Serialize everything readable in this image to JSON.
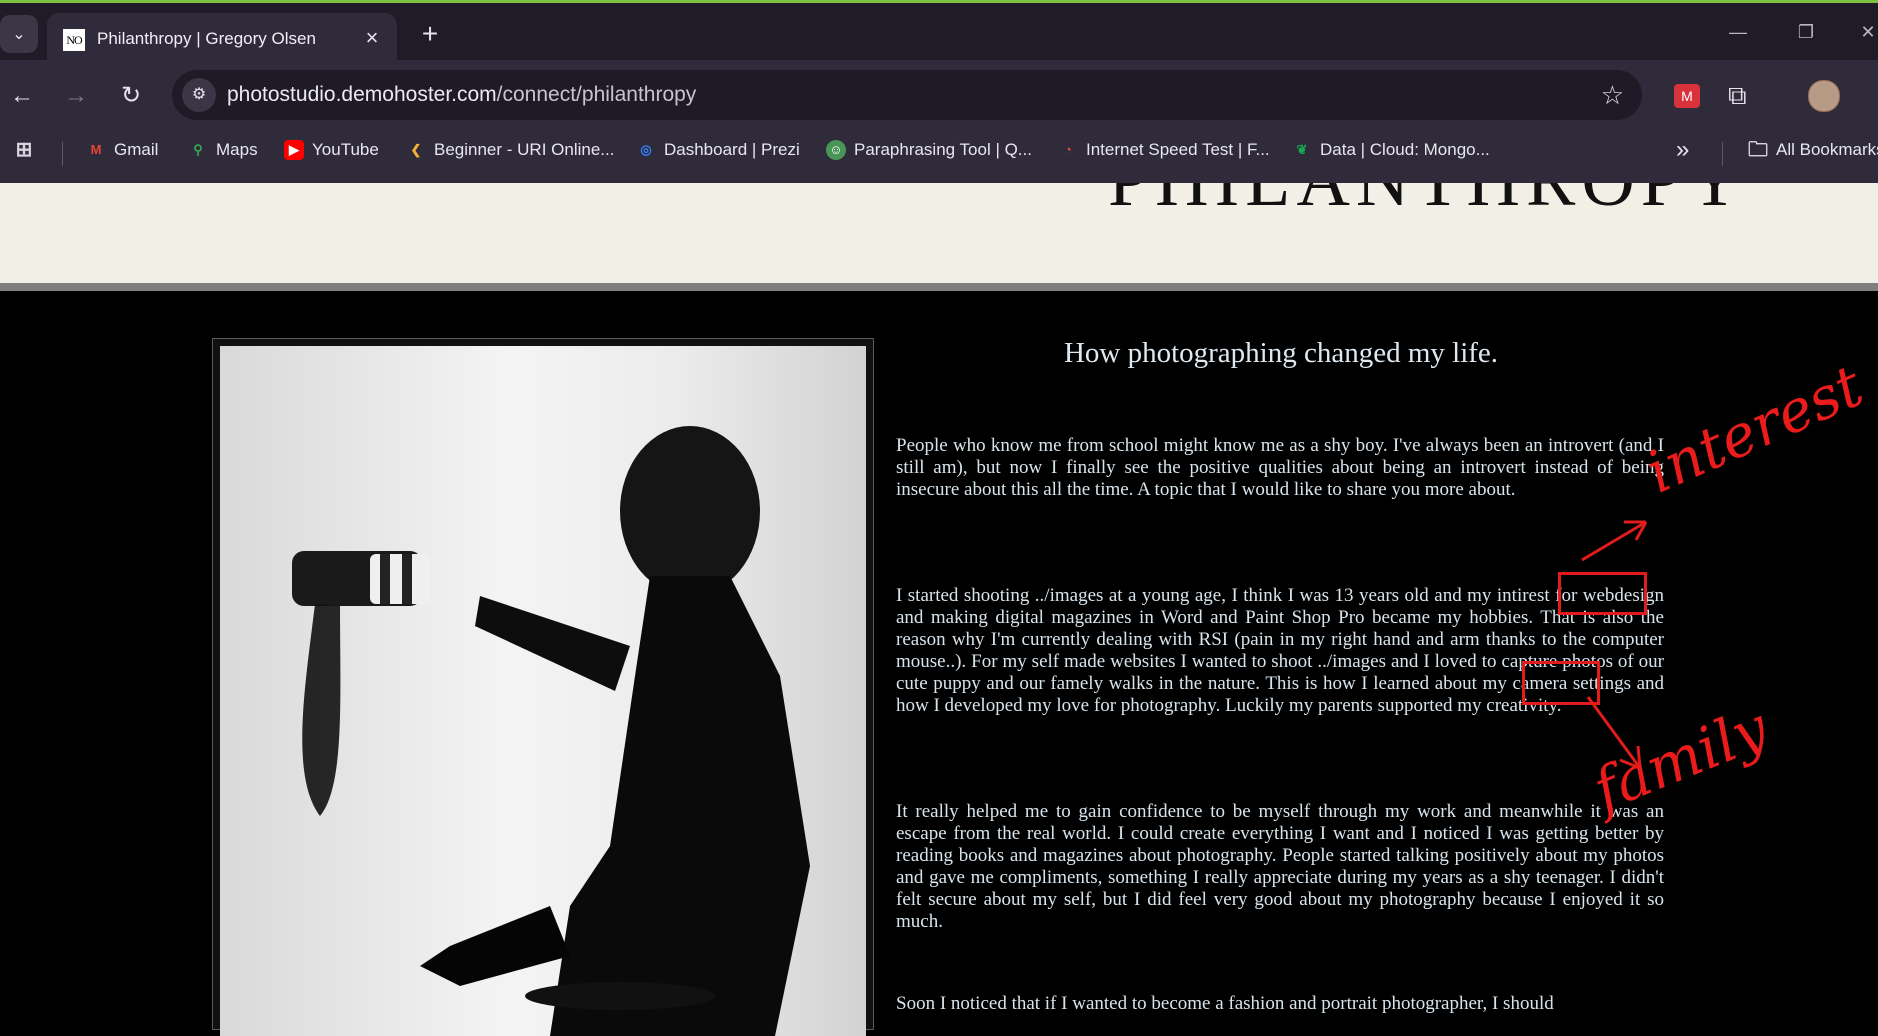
{
  "browser": {
    "tab_title": "Philanthropy | Gregory Olsen",
    "favicon_text": "NO",
    "url_domain": "photostudio.demohoster.com",
    "url_path": "/connect/philanthropy",
    "bookmarks": [
      {
        "label": "Gmail",
        "icon": "gmail-icon",
        "color": "#ea4335"
      },
      {
        "label": "Maps",
        "icon": "maps-icon",
        "color": "#34a853"
      },
      {
        "label": "YouTube",
        "icon": "youtube-icon",
        "color": "#ff0000"
      },
      {
        "label": "Beginner - URI Online...",
        "icon": "uri-icon",
        "color": "#f2b233"
      },
      {
        "label": "Dashboard | Prezi",
        "icon": "prezi-icon",
        "color": "#3181ff"
      },
      {
        "label": "Paraphrasing Tool | Q...",
        "icon": "quillbot-icon",
        "color": "#499557"
      },
      {
        "label": "Internet Speed Test | F...",
        "icon": "speedtest-icon",
        "color": "#e14b3b"
      },
      {
        "label": "Data | Cloud: Mongo...",
        "icon": "mongodb-icon",
        "color": "#13aa52"
      }
    ],
    "all_bookmarks": "All Bookmarks"
  },
  "page": {
    "header_title": "PHILANTHROPY",
    "article_title": "How photographing changed my life.",
    "paragraphs": [
      "People who know me from school might know me as a shy boy. I've always been an introvert (and I still am), but now I finally see the positive qualities about being an introvert instead of being insecure about this all the time. A topic that I would like to share you more about.",
      "I started shooting ../images at a young age, I think I was 13 years old and my intirest for webdesign and making digital magazines in Word and Paint Shop Pro became my hobbies. That is also the reason why I'm currently dealing with RSI (pain in my right hand and arm thanks to the computer mouse..). For my self made websites I wanted to shoot ../images and I loved to capture photos of our cute puppy and our famely walks in the nature. This is how I learned about my camera settings and how I developed my love for photography. Luckily my parents supported my creativity.",
      "It really helped me to gain confidence to be myself through my work and meanwhile it was an escape from the real world. I could create everything I want and I noticed I was getting better by reading books and magazines about photography. People started talking positively about my photos and gave me compliments, something I really appreciate during my years as a shy teenager. I didn't felt secure about my self, but I did feel very good about my photography because I enjoyed it so much.",
      "Soon I noticed that if I wanted to become a fashion and portrait photographer, I should"
    ]
  },
  "annotations": {
    "interest": "interest",
    "family": "family",
    "color": "#e21b1b"
  }
}
